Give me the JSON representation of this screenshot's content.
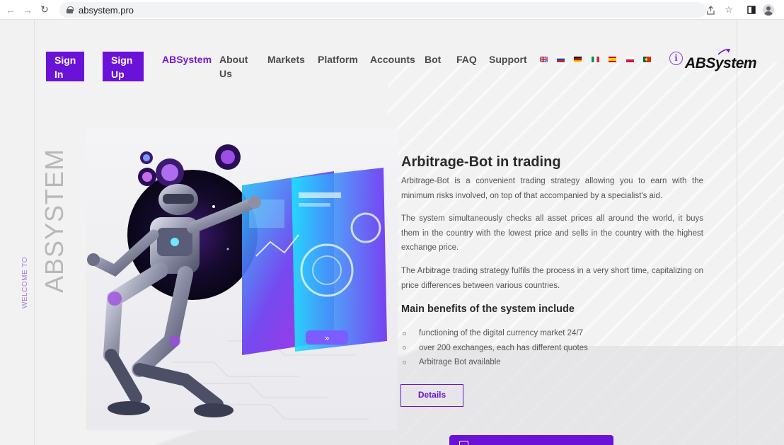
{
  "browser": {
    "url": "absystem.pro"
  },
  "header": {
    "sign_in": "Sign In",
    "sign_up": "Sign Up",
    "nav": [
      {
        "label": "ABSystem",
        "active": true
      },
      {
        "label": "About Us"
      },
      {
        "label": "Markets"
      },
      {
        "label": "Platform"
      },
      {
        "label": "Accounts"
      },
      {
        "label": "Bot"
      },
      {
        "label": "FAQ"
      },
      {
        "label": "Support"
      }
    ],
    "languages": [
      "en",
      "ru",
      "de",
      "it",
      "es",
      "pl",
      "pt"
    ],
    "logo": "ABSystem"
  },
  "side": {
    "welcome": "WELCOME TO",
    "brand": "ABSYSTEM"
  },
  "content": {
    "title": "Arbitrage-Bot in trading",
    "paragraphs": [
      "Arbitrage-Bot is a convenient trading strategy allowing you to earn with the minimum risks involved, on top of that accompanied by a specialist's aid.",
      "The system simultaneously checks all asset prices all around the world, it buys them in the country with the lowest price and sells in the country with the highest exchange price.",
      "The Arbitrage trading strategy fulfils the process in a very short time, capitalizing on price differences between various countries."
    ],
    "benefits_title": "Main benefits of the system include",
    "benefits": [
      "functioning of the digital currency market 24/7",
      "over 200 exchanges, each has different quotes",
      "Arbitrage Bot available"
    ],
    "details_button": "Details"
  },
  "colors": {
    "accent": "#6a12d8",
    "nav_active": "#7418d4"
  }
}
